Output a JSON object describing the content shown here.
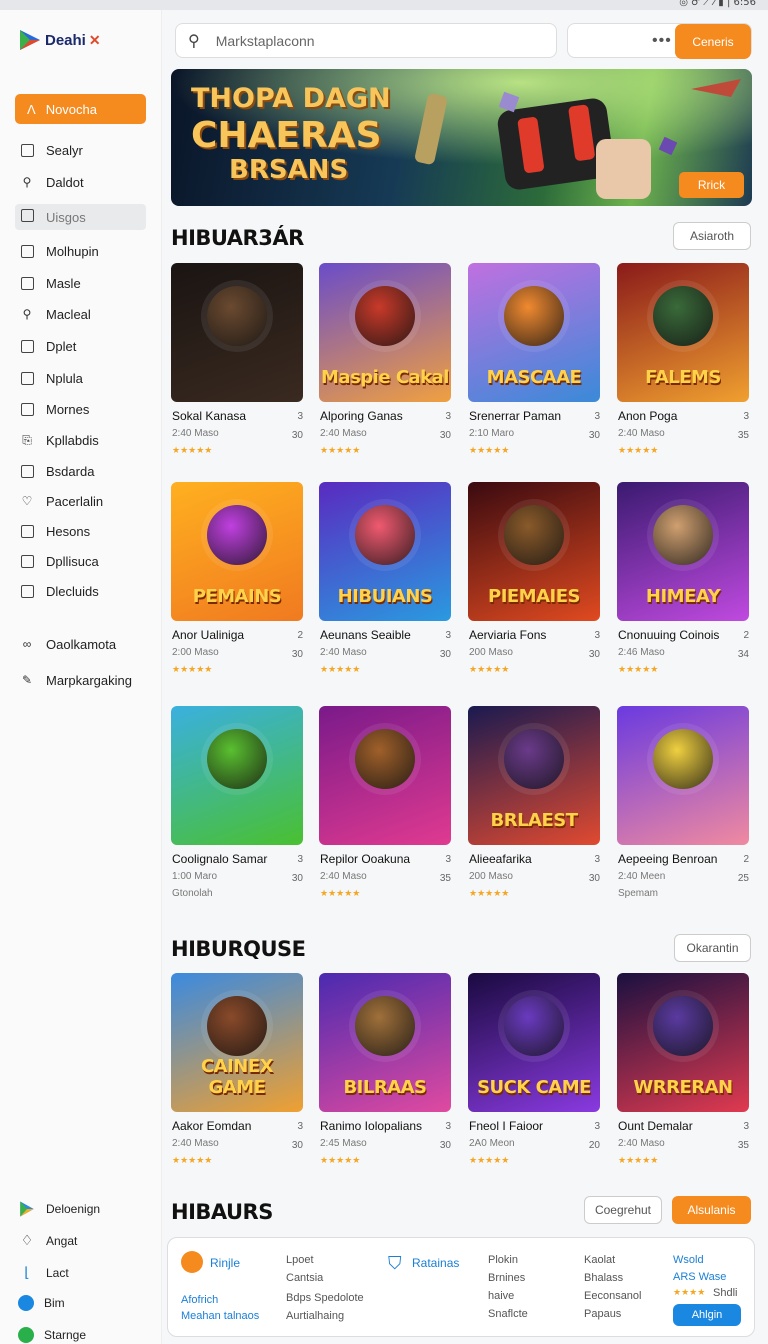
{
  "status_bar": {
    "text": "◎ ♂ ⟋ ⁄ ▮ | 6:56"
  },
  "app": {
    "logo_text": "Deahi"
  },
  "sidebar": {
    "active": {
      "label": "Novocha",
      "icon": "letter-a-icon"
    },
    "selected": {
      "label": "Uisgos"
    },
    "items": [
      {
        "label": "Sealyr",
        "icon": "document-icon"
      },
      {
        "label": "Daldot",
        "icon": "key-icon"
      },
      {
        "label": "Molhupin",
        "icon": "box-icon"
      },
      {
        "label": "Masle",
        "icon": "grid-icon"
      },
      {
        "label": "Macleal",
        "icon": "search-icon"
      },
      {
        "label": "Dplet",
        "icon": "box-icon"
      },
      {
        "label": "Nplula",
        "icon": "image-icon"
      },
      {
        "label": "Mornes",
        "icon": "checkbox-icon"
      },
      {
        "label": "Kpllabdis",
        "icon": "puzzle-icon"
      },
      {
        "label": "Bsdarda",
        "icon": "file-icon"
      },
      {
        "label": "Pacerlalin",
        "icon": "heart-icon"
      },
      {
        "label": "Hesons",
        "icon": "card-icon"
      },
      {
        "label": "Dpllisuca",
        "icon": "box-icon"
      },
      {
        "label": "Dlecluids",
        "icon": "list-icon"
      }
    ],
    "secondary": [
      {
        "label": "Oaolkamota",
        "icon": "link-icon"
      },
      {
        "label": "Marpkargaking",
        "icon": "pen-icon"
      }
    ],
    "footer": [
      {
        "label": "Deloenign",
        "icon": "play-store-icon"
      },
      {
        "label": "Angat",
        "icon": "bulb-icon"
      },
      {
        "label": "Lact",
        "icon": "bracket-icon"
      },
      {
        "label": "Bim",
        "icon": "blue-circle-icon"
      },
      {
        "label": "Starnge",
        "icon": "green-circle-icon"
      }
    ]
  },
  "search": {
    "placeholder": "Markstaplaconn"
  },
  "header": {
    "action_button": "Ceneris",
    "more": "•••"
  },
  "hero": {
    "line1": "THOPA DAGN",
    "line2": "CHAERAS",
    "line3": "BRSANS",
    "button": "Rrick"
  },
  "sections": [
    {
      "title": "HIBUAR3ÁR",
      "button": "Asiaroth",
      "cards": [
        {
          "name": "Sokal Kanasa",
          "num1": "3",
          "meta": "2:40 Maso",
          "num2": "30",
          "stars": "★★★★★",
          "thumb_label": "",
          "colors": [
            "#1a1412",
            "#3a2a20"
          ],
          "face": "#6b4a30"
        },
        {
          "name": "Alporing Ganas",
          "num1": "3",
          "meta": "2:40 Maso",
          "num2": "30",
          "stars": "★★★★★",
          "thumb_label": "Maspie Cakal",
          "colors": [
            "#6a4cc9",
            "#f0a040"
          ],
          "face": "#c83a2a"
        },
        {
          "name": "Srenerrar Paman",
          "num1": "3",
          "meta": "2:10 Maro",
          "num2": "30",
          "stars": "★★★★★",
          "thumb_label": "MASCAAE",
          "colors": [
            "#c070e0",
            "#3a8ad8"
          ],
          "face": "#f08a30"
        },
        {
          "name": "Anon Poga",
          "num1": "3",
          "meta": "2:40 Maso",
          "num2": "35",
          "stars": "★★★★★",
          "thumb_label": "FALEMS",
          "colors": [
            "#8a1a1a",
            "#f0a030"
          ],
          "face": "#3a6a3a"
        }
      ]
    },
    {
      "title": "",
      "button": "",
      "cards": [
        {
          "name": "Anor Ualiniga",
          "num1": "2",
          "meta": "2:00 Maso",
          "num2": "30",
          "stars": "★★★★★",
          "thumb_label": "PEMAINS",
          "colors": [
            "#ffb020",
            "#f07a20"
          ],
          "face": "#c040e0"
        },
        {
          "name": "Aeunans Seaible",
          "num1": "3",
          "meta": "2:40 Maso",
          "num2": "30",
          "stars": "★★★★★",
          "thumb_label": "HIBUIANS",
          "colors": [
            "#5a2ac0",
            "#2a9ae0"
          ],
          "face": "#f05a70"
        },
        {
          "name": "Aerviaria Fons",
          "num1": "3",
          "meta": "200 Maso",
          "num2": "30",
          "stars": "★★★★★",
          "thumb_label": "PIEMAIES",
          "colors": [
            "#3a0a10",
            "#e04a20"
          ],
          "face": "#8a5a2a"
        },
        {
          "name": "Cnonuuing Coinois",
          "num1": "2",
          "meta": "2:46 Maso",
          "num2": "34",
          "stars": "★★★★★",
          "thumb_label": "HIMEAY",
          "colors": [
            "#3a1a70",
            "#c04ae0"
          ],
          "face": "#d0a070"
        }
      ]
    },
    {
      "title": "",
      "button": "",
      "cards": [
        {
          "name": "Coolignalo Samar",
          "num1": "3",
          "meta": "1:00 Maro",
          "num2": "30",
          "stars": "",
          "extra": "Gtonolah",
          "thumb_label": "",
          "colors": [
            "#3ab0e0",
            "#4ac030"
          ],
          "face": "#5ac030"
        },
        {
          "name": "Repilor Ooakuna",
          "num1": "3",
          "meta": "2:40 Maso",
          "num2": "35",
          "stars": "★★★★★",
          "thumb_label": "",
          "colors": [
            "#7a1a8a",
            "#e03a90"
          ],
          "face": "#a0602a"
        },
        {
          "name": "Alieeafarika",
          "num1": "3",
          "meta": "200 Maso",
          "num2": "30",
          "stars": "★★★★★",
          "thumb_label": "BRLAEST",
          "colors": [
            "#1a1a50",
            "#e04a30"
          ],
          "face": "#6a3a8a"
        },
        {
          "name": "Aepeeing Benroan",
          "num1": "2",
          "meta": "2:40 Meen",
          "num2": "25",
          "stars": "",
          "extra": "Spemam",
          "thumb_label": "",
          "colors": [
            "#6a3ae0",
            "#f08aa0"
          ],
          "face": "#f0d040"
        }
      ]
    },
    {
      "title": "HIBURQUSE",
      "button": "Okarantin",
      "cards": [
        {
          "name": "Aakor Eomdan",
          "num1": "3",
          "meta": "2:40 Maso",
          "num2": "30",
          "stars": "★★★★★",
          "thumb_label": "CAINEX GAME",
          "colors": [
            "#3a8ae0",
            "#f0a030"
          ],
          "face": "#8a4a2a"
        },
        {
          "name": "Ranimo Iolopalians",
          "num1": "3",
          "meta": "2:45 Maso",
          "num2": "30",
          "stars": "★★★★★",
          "thumb_label": "BILRAAS",
          "colors": [
            "#4a2ab0",
            "#e04aa0"
          ],
          "face": "#a0703a"
        },
        {
          "name": "Fneol I Faioor",
          "num1": "3",
          "meta": "2A0 Meon",
          "num2": "20",
          "stars": "★★★★★",
          "thumb_label": "SUCK CAME",
          "colors": [
            "#1a0a40",
            "#8a3ae0"
          ],
          "face": "#6a3ac0"
        },
        {
          "name": "Ount Demalar",
          "num1": "3",
          "meta": "2:40 Maso",
          "num2": "35",
          "stars": "★★★★★",
          "thumb_label": "WRRERAN",
          "colors": [
            "#1a1040",
            "#e03a50"
          ],
          "face": "#5a3aa0"
        }
      ]
    },
    {
      "title": "HIBAURS",
      "button": "Coegrehut",
      "button2": "Alsulanis"
    }
  ],
  "panel": {
    "col1": {
      "title": "Rinjle",
      "link": "Afofrich",
      "link2": "Meahan talnaos"
    },
    "col2": [
      "Lpoet",
      "Cantsia",
      "Bdps Spedolote",
      "Aurtialhaing"
    ],
    "col3": {
      "title": "Ratainas"
    },
    "col4": [
      "Plokin",
      "Brnines",
      "haive",
      "Snaflcte"
    ],
    "col5": [
      "Kaolat",
      "Bhalass",
      "Eeconsanol",
      "Papaus"
    ],
    "col6": {
      "line1": "Wsold",
      "line2": "ARS Wase",
      "stars": "★★★★",
      "line3": "Shdli"
    },
    "button": "Ahlgin"
  },
  "colors": {
    "accent": "#f58a1f",
    "blue": "#1a88e0"
  }
}
